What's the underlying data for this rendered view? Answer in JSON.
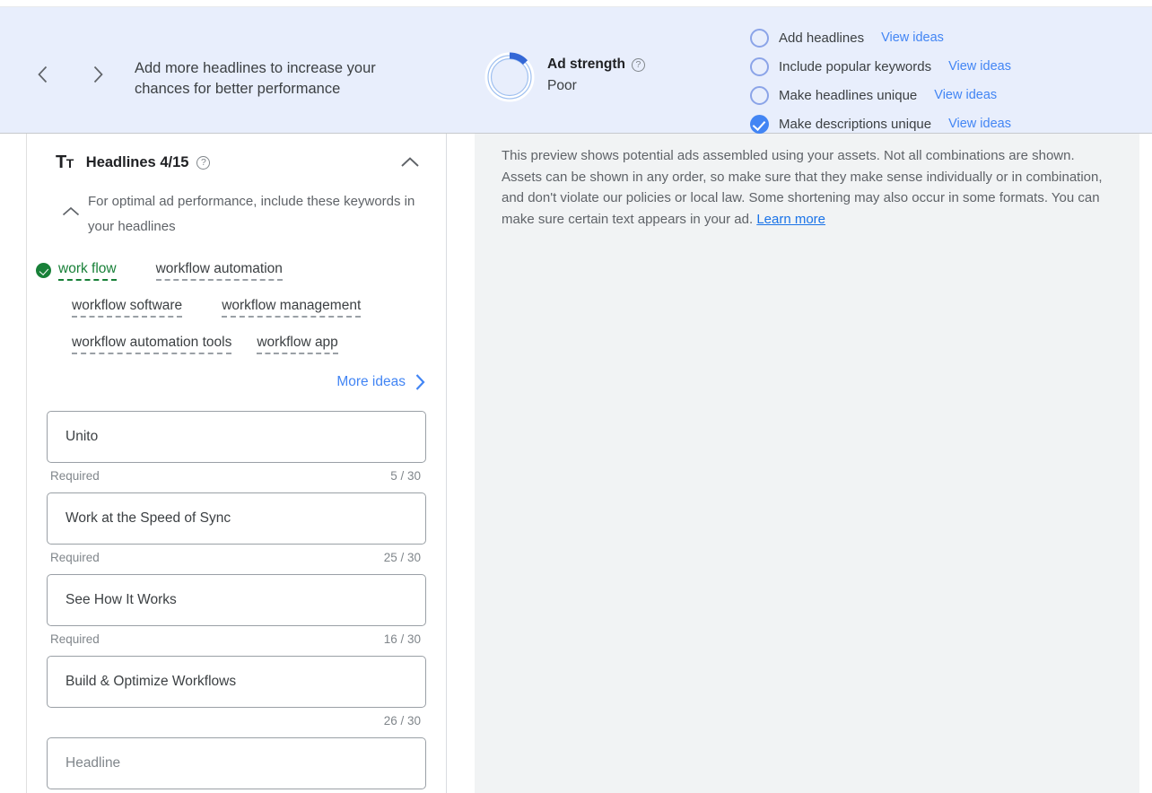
{
  "banner": {
    "prev_label": "Previous",
    "next_label": "Next",
    "message": "Add more headlines to increase your chances for better performance",
    "ad_strength": {
      "label": "Ad strength",
      "value": "Poor",
      "help": "?",
      "ring_percent": 13,
      "ring_color": "#3367d6",
      "ring_track_color": "#c9dbf7"
    },
    "checklist": [
      {
        "label": "Add headlines",
        "link": "View ideas",
        "done": false
      },
      {
        "label": "Include popular keywords",
        "link": "View ideas",
        "done": false
      },
      {
        "label": "Make headlines unique",
        "link": "View ideas",
        "done": false
      },
      {
        "label": "Make descriptions unique",
        "link": "View ideas",
        "done": true
      }
    ]
  },
  "headlines_section": {
    "icon": "text-format-icon",
    "title": "Headlines 4/15",
    "help": "?",
    "collapse_label": "Collapse",
    "keyword_hint": "For optimal ad performance, include these keywords in your headlines",
    "keywords": [
      {
        "text": "work flow",
        "matched": true
      },
      {
        "text": "workflow automation",
        "matched": false
      },
      {
        "text": "workflow software",
        "matched": false
      },
      {
        "text": "workflow management",
        "matched": false
      },
      {
        "text": "workflow automation tools",
        "matched": false
      },
      {
        "text": "workflow app",
        "matched": false
      }
    ],
    "more_ideas": "More ideas",
    "fields": [
      {
        "value": "Unito",
        "placeholder": "Headline",
        "required": "Required",
        "counter": "5 / 30"
      },
      {
        "value": "Work at the Speed of Sync",
        "placeholder": "Headline",
        "required": "Required",
        "counter": "25 / 30"
      },
      {
        "value": "See How It Works",
        "placeholder": "Headline",
        "required": "Required",
        "counter": "16 / 30"
      },
      {
        "value": "Build & Optimize Workflows",
        "placeholder": "Headline",
        "required": "",
        "counter": "26 / 30"
      },
      {
        "value": "",
        "placeholder": "Headline",
        "required": "",
        "counter": ""
      }
    ]
  },
  "preview": {
    "note_part1": "This preview shows potential ads assembled using your assets. Not all combinations are shown. Assets can be shown in any order, so make sure that they make sense individually or in combination, and don't violate our policies or local law. Some shortening may also occur in some formats. You can make sure certain text appears in your ad. ",
    "learn_more": "Learn more"
  },
  "colors": {
    "banner_bg": "#e8eefc",
    "accent_blue": "#4285f4",
    "link_blue": "#1a73e8",
    "match_green": "#188038",
    "panel_gray": "#f1f3f4"
  }
}
